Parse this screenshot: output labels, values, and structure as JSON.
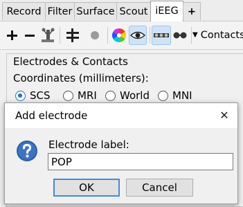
{
  "tabs": [
    {
      "label": "Record"
    },
    {
      "label": "Filter"
    },
    {
      "label": "Surface"
    },
    {
      "label": "Scout"
    },
    {
      "label": "iEEG",
      "active": true
    },
    {
      "label": "+"
    }
  ],
  "toolbar": {
    "icons": [
      "add-icon",
      "remove-icon",
      "electrode-model-icon",
      "align-icon",
      "gray-dot-icon",
      "color-wheel-icon",
      "eye-icon",
      "display-contacts-icon",
      "display-electrodes-icon"
    ],
    "contacts_menu_label": "Contacts"
  },
  "panel": {
    "section_title": "Electrodes & Contacts",
    "coordinates_label": "Coordinates (millimeters):",
    "coordinate_options": [
      {
        "label": "SCS",
        "selected": true
      },
      {
        "label": "MRI",
        "selected": false
      },
      {
        "label": "World",
        "selected": false
      },
      {
        "label": "MNI",
        "selected": false
      }
    ]
  },
  "dialog": {
    "title": "Add electrode",
    "close_symbol": "✕",
    "field_label": "Electrode label:",
    "field_value": "POP",
    "ok_label": "OK",
    "cancel_label": "Cancel"
  },
  "colors": {
    "accent": "#1a73c9",
    "pressed_bg": "#cfe3f7",
    "question_icon": "#2a5ea8"
  }
}
